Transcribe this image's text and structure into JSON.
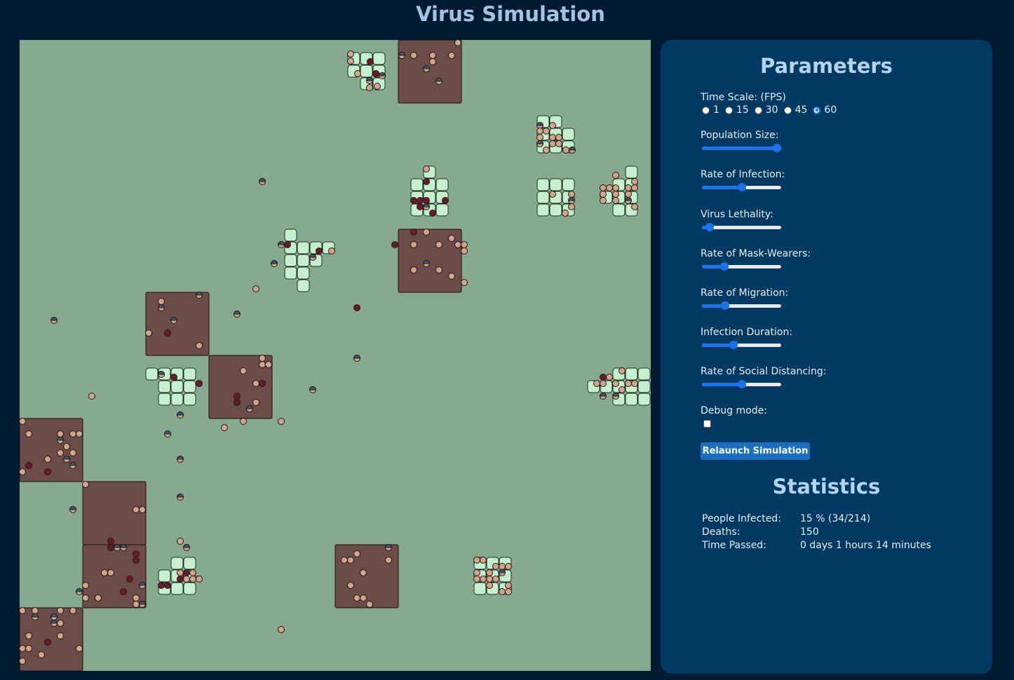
{
  "header": {
    "title": "Virus Simulation"
  },
  "colors": {
    "background": "#001b30",
    "canvas": "#87a98f",
    "building": "#6b4c48",
    "tile": "#c6f0cd",
    "healthy": "#d4a489",
    "infected": "#6b1a2b",
    "masked_top": "#44566a",
    "grave": "#5b6c80",
    "panel": "#003a63",
    "accent": "#1a73e8"
  },
  "parameters": {
    "title": "Parameters",
    "time_scale": {
      "label": "Time Scale: (FPS)",
      "options": [
        "1",
        "15",
        "30",
        "45",
        "60"
      ],
      "selected": "60"
    },
    "population_size": {
      "label": "Population Size:",
      "level": 0.95
    },
    "rate_of_infection": {
      "label": "Rate of Infection:",
      "level": 0.5
    },
    "virus_lethality": {
      "label": "Virus Lethality:",
      "level": 0.1
    },
    "rate_of_mask_wearers": {
      "label": "Rate of Mask-Wearers:",
      "level": 0.28
    },
    "rate_of_migration": {
      "label": "Rate of Migration:",
      "level": 0.29
    },
    "infection_duration": {
      "label": "Infection Duration:",
      "level": 0.4
    },
    "rate_of_social_distancing": {
      "label": "Rate of Social Distancing:",
      "level": 0.5
    },
    "debug_mode": {
      "label": "Debug mode:",
      "checked": false
    },
    "relaunch_label": "Relaunch Simulation"
  },
  "statistics": {
    "title": "Statistics",
    "people_infected_label": "People Infected:",
    "people_infected_value": "15 % (34/214)",
    "deaths_label": "Deaths:",
    "deaths_value": "150",
    "time_passed_label": "Time Passed:",
    "time_passed_value": "0 days 1 hours 14 minutes"
  }
}
